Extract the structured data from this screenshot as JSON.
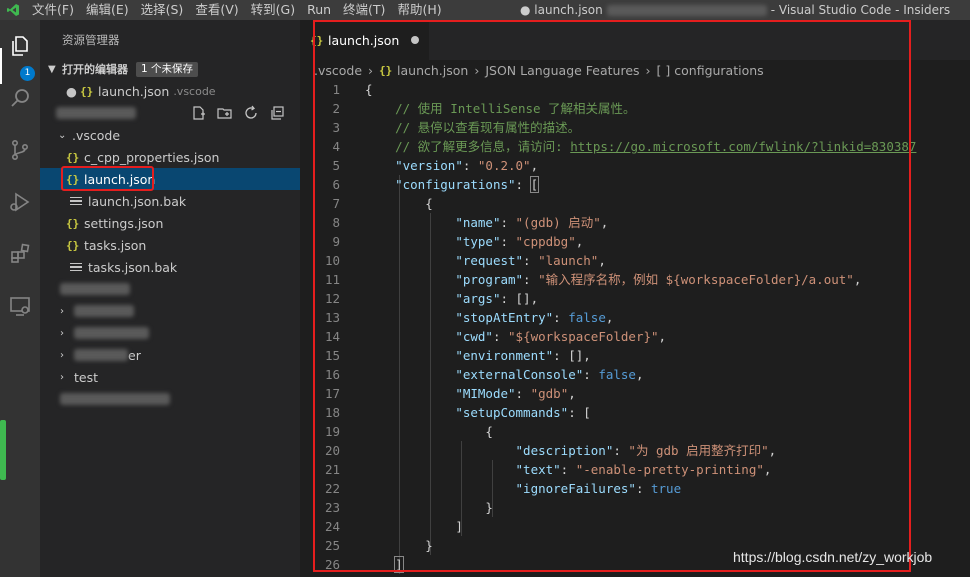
{
  "titlebar": {
    "menus": [
      "文件(F)",
      "编辑(E)",
      "选择(S)",
      "查看(V)",
      "转到(G)",
      "Run",
      "终端(T)",
      "帮助(H)"
    ],
    "title_file": "● launch.json",
    "title_app": "- Visual Studio Code - Insiders"
  },
  "activity": {
    "icons": [
      "files-icon",
      "search-icon",
      "source-control-icon",
      "run-debug-icon",
      "extensions-icon",
      "remote-explorer-icon"
    ],
    "badge": "1"
  },
  "sidebar": {
    "header": "资源管理器",
    "open_editors_label": "打开的编辑器",
    "unsaved_badge": "1 个未保存",
    "open_editor_file": "launch.json",
    "open_editor_desc": ".vscode",
    "tree": {
      "folder": ".vscode",
      "files": [
        {
          "name": "c_cpp_properties.json",
          "icon": "json"
        },
        {
          "name": "launch.json",
          "icon": "json"
        },
        {
          "name": "launch.json.bak",
          "icon": "lines"
        },
        {
          "name": "settings.json",
          "icon": "json"
        },
        {
          "name": "tasks.json",
          "icon": "json"
        },
        {
          "name": "tasks.json.bak",
          "icon": "lines"
        }
      ],
      "partial_folder_suffix": "er",
      "test_folder": "test"
    }
  },
  "editor": {
    "tab_label": "launch.json",
    "breadcrumb": [
      ".vscode",
      "launch.json",
      "JSON Language Features",
      "[ ] configurations"
    ],
    "lines": [
      "1",
      "2",
      "3",
      "4",
      "5",
      "6",
      "7",
      "8",
      "9",
      "10",
      "11",
      "12",
      "13",
      "14",
      "15",
      "16",
      "17",
      "18",
      "19",
      "20",
      "21",
      "22",
      "23",
      "24",
      "25",
      "26"
    ],
    "code": {
      "c1": "// 使用 IntelliSense 了解相关属性。",
      "c2": "// 悬停以查看现有属性的描述。",
      "c3a": "// 欲了解更多信息，请访问: ",
      "c3b": "https://go.microsoft.com/fwlink/?linkid=830387",
      "version_k": "\"version\"",
      "version_v": "\"0.2.0\"",
      "configurations_k": "\"configurations\"",
      "name_k": "\"name\"",
      "name_v": "\"(gdb) 启动\"",
      "type_k": "\"type\"",
      "type_v": "\"cppdbg\"",
      "request_k": "\"request\"",
      "request_v": "\"launch\"",
      "program_k": "\"program\"",
      "program_v": "\"输入程序名称，例如 ${workspaceFolder}/a.out\"",
      "args_k": "\"args\"",
      "stop_k": "\"stopAtEntry\"",
      "false1": "false",
      "cwd_k": "\"cwd\"",
      "cwd_v": "\"${workspaceFolder}\"",
      "env_k": "\"environment\"",
      "ext_k": "\"externalConsole\"",
      "false2": "false",
      "mimode_k": "\"MIMode\"",
      "mimode_v": "\"gdb\"",
      "setup_k": "\"setupCommands\"",
      "desc_k": "\"description\"",
      "desc_v": "\"为 gdb 启用整齐打印\"",
      "text_k": "\"text\"",
      "text_v": "\"-enable-pretty-printing\"",
      "ignore_k": "\"ignoreFailures\"",
      "true1": "true"
    }
  },
  "watermark": "https://blog.csdn.net/zy_workjob"
}
